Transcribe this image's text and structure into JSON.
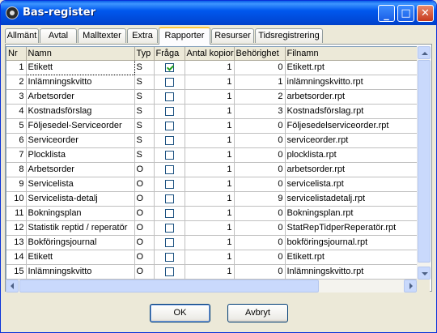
{
  "window": {
    "title": "Bas-register"
  },
  "tabs": [
    {
      "label": "Allmänt"
    },
    {
      "label": "Avtal"
    },
    {
      "label": "Malltexter"
    },
    {
      "label": "Extra"
    },
    {
      "label": "Rapporter"
    },
    {
      "label": "Resurser"
    },
    {
      "label": "Tidsregistrering"
    }
  ],
  "active_tab": "Rapporter",
  "table": {
    "columns": [
      "Nr",
      "Namn",
      "Typ",
      "Fråga",
      "Antal kopior",
      "Behörighet",
      "Filnamn"
    ],
    "rows": [
      {
        "nr": "1",
        "namn": "Etikett",
        "typ": "S",
        "fraga": true,
        "antal": "1",
        "behorighet": "0",
        "filnamn": "Etikett.rpt"
      },
      {
        "nr": "2",
        "namn": "Inlämningskvitto",
        "typ": "S",
        "fraga": false,
        "antal": "1",
        "behorighet": "1",
        "filnamn": "inlämningskvitto.rpt"
      },
      {
        "nr": "3",
        "namn": "Arbetsorder",
        "typ": "S",
        "fraga": false,
        "antal": "1",
        "behorighet": "2",
        "filnamn": "arbetsorder.rpt"
      },
      {
        "nr": "4",
        "namn": "Kostnadsförslag",
        "typ": "S",
        "fraga": false,
        "antal": "1",
        "behorighet": "3",
        "filnamn": "Kostnadsförslag.rpt"
      },
      {
        "nr": "5",
        "namn": "Följesedel-Serviceorder",
        "typ": "S",
        "fraga": false,
        "antal": "1",
        "behorighet": "0",
        "filnamn": "Följesedelserviceorder.rpt"
      },
      {
        "nr": "6",
        "namn": "Serviceorder",
        "typ": "S",
        "fraga": false,
        "antal": "1",
        "behorighet": "0",
        "filnamn": "serviceorder.rpt"
      },
      {
        "nr": "7",
        "namn": "Plocklista",
        "typ": "S",
        "fraga": false,
        "antal": "1",
        "behorighet": "0",
        "filnamn": "plocklista.rpt"
      },
      {
        "nr": "8",
        "namn": "Arbetsorder",
        "typ": "O",
        "fraga": false,
        "antal": "1",
        "behorighet": "0",
        "filnamn": "arbetsorder.rpt"
      },
      {
        "nr": "9",
        "namn": "Servicelista",
        "typ": "O",
        "fraga": false,
        "antal": "1",
        "behorighet": "0",
        "filnamn": "servicelista.rpt"
      },
      {
        "nr": "10",
        "namn": "Servicelista-detalj",
        "typ": "O",
        "fraga": false,
        "antal": "1",
        "behorighet": "9",
        "filnamn": "servicelistadetalj.rpt"
      },
      {
        "nr": "11",
        "namn": "Bokningsplan",
        "typ": "O",
        "fraga": false,
        "antal": "1",
        "behorighet": "0",
        "filnamn": "Bokningsplan.rpt"
      },
      {
        "nr": "12",
        "namn": "Statistik reptid / reperatör",
        "typ": "O",
        "fraga": false,
        "antal": "1",
        "behorighet": "0",
        "filnamn": "StatRepTidperReperatör.rpt"
      },
      {
        "nr": "13",
        "namn": "Bokföringsjournal",
        "typ": "O",
        "fraga": false,
        "antal": "1",
        "behorighet": "0",
        "filnamn": "bokföringsjournal.rpt"
      },
      {
        "nr": "14",
        "namn": "Etikett",
        "typ": "O",
        "fraga": false,
        "antal": "1",
        "behorighet": "0",
        "filnamn": "Etikett.rpt"
      },
      {
        "nr": "15",
        "namn": "Inlämningskvitto",
        "typ": "O",
        "fraga": false,
        "antal": "1",
        "behorighet": "0",
        "filnamn": "Inlämningskvitto.rpt"
      }
    ]
  },
  "buttons": {
    "ok": "OK",
    "cancel": "Avbryt"
  },
  "colors": {
    "titlebar": "#0054e3",
    "active_tab_accent": "#ffc83c",
    "check": "#21a121"
  }
}
